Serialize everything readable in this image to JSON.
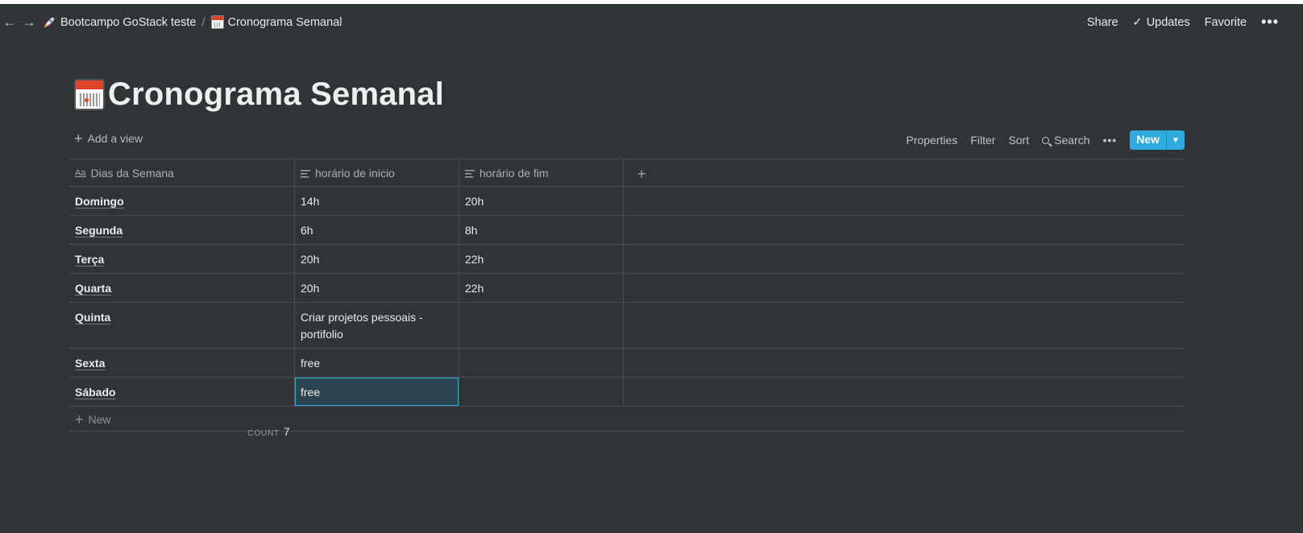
{
  "topbar": {
    "back_icon": "arrow-left-icon",
    "forward_icon": "arrow-right-icon",
    "breadcrumbs": [
      {
        "icon": "rocket-icon",
        "label": "Bootcampo GoStack teste"
      },
      {
        "icon": "calendar-icon",
        "label": "Cronograma Semanal"
      }
    ],
    "separator": "/",
    "share": "Share",
    "updates": "Updates",
    "favorite": "Favorite",
    "more": "•••"
  },
  "page": {
    "title": "Cronograma Semanal",
    "icon": "calendar-icon"
  },
  "toolbar": {
    "add_view": "Add a view",
    "properties": "Properties",
    "filter": "Filter",
    "sort": "Sort",
    "search": "Search",
    "more": "•••",
    "new": "New"
  },
  "table": {
    "columns": [
      {
        "label": "Dias da Semana",
        "icon": "title-aa-icon"
      },
      {
        "label": "horário de inicio",
        "icon": "text-lines-icon"
      },
      {
        "label": "horário de fim",
        "icon": "text-lines-icon"
      }
    ],
    "rows": [
      {
        "dia": "Domingo",
        "inicio": "14h",
        "fim": "20h"
      },
      {
        "dia": "Segunda",
        "inicio": "6h",
        "fim": "8h"
      },
      {
        "dia": "Terça",
        "inicio": "20h",
        "fim": "22h"
      },
      {
        "dia": "Quarta",
        "inicio": "20h",
        "fim": "22h"
      },
      {
        "dia": "Quinta",
        "inicio": "Criar projetos pessoais - portifolio",
        "fim": ""
      },
      {
        "dia": "Sexta",
        "inicio": "free",
        "fim": ""
      },
      {
        "dia": "Sábado",
        "inicio": "free",
        "fim": ""
      }
    ],
    "new_row": "New",
    "count_label": "COUNT",
    "count_value": "7"
  },
  "colors": {
    "background": "#2f3437",
    "accent": "#2eaadc"
  }
}
